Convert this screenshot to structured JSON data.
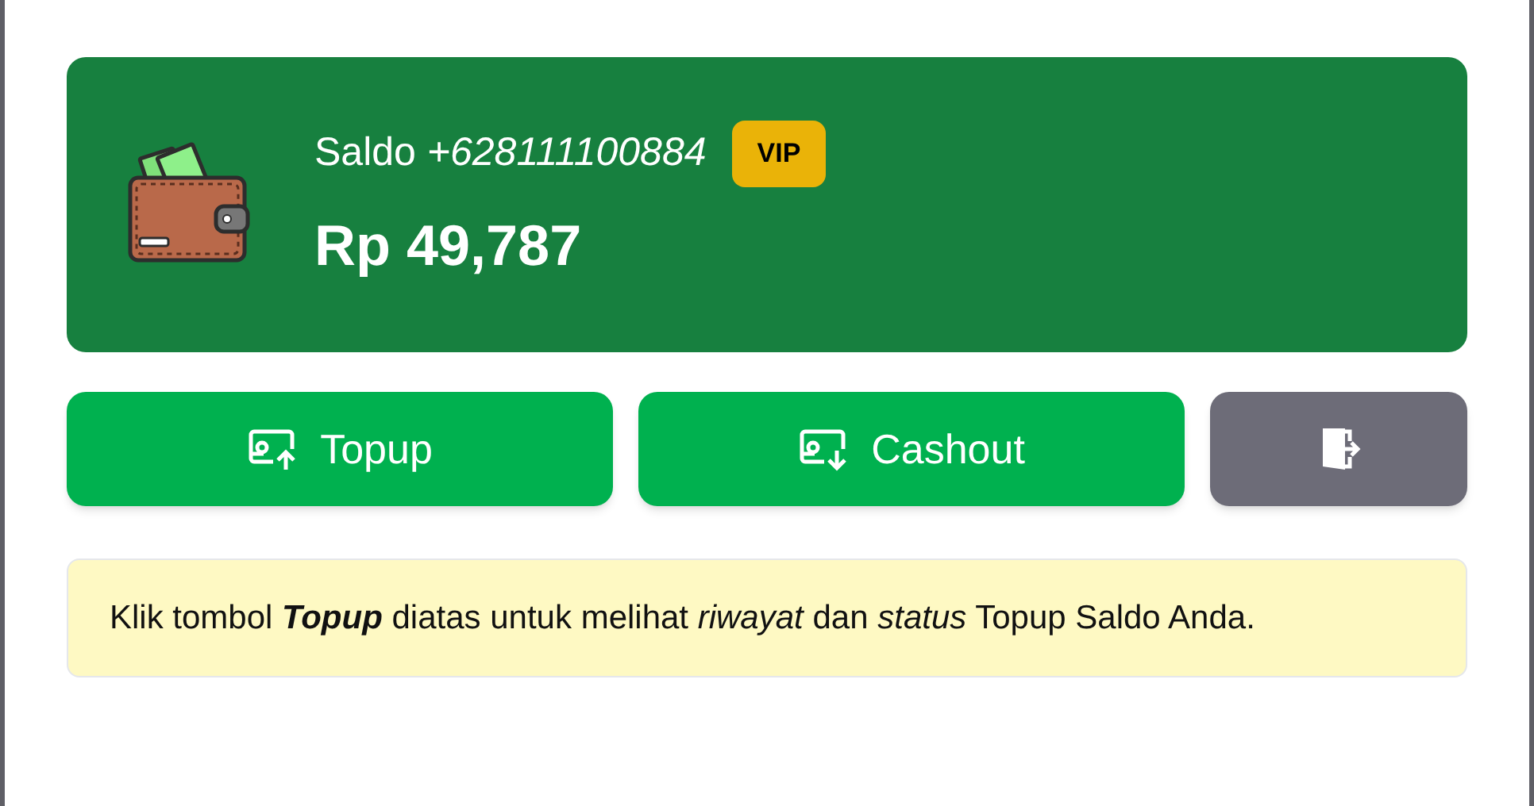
{
  "balance_card": {
    "label": "Saldo *+628111100884*",
    "badge": "VIP",
    "amount": "Rp 49,787"
  },
  "actions": [
    {
      "kind": "topup",
      "label": "Topup"
    },
    {
      "kind": "cashout",
      "label": "Cashout"
    },
    {
      "kind": "logout"
    }
  ],
  "notice": "Klik tombol **Topup** diatas untuk melihat *riwayat* dan *status* Topup Saldo Anda."
}
